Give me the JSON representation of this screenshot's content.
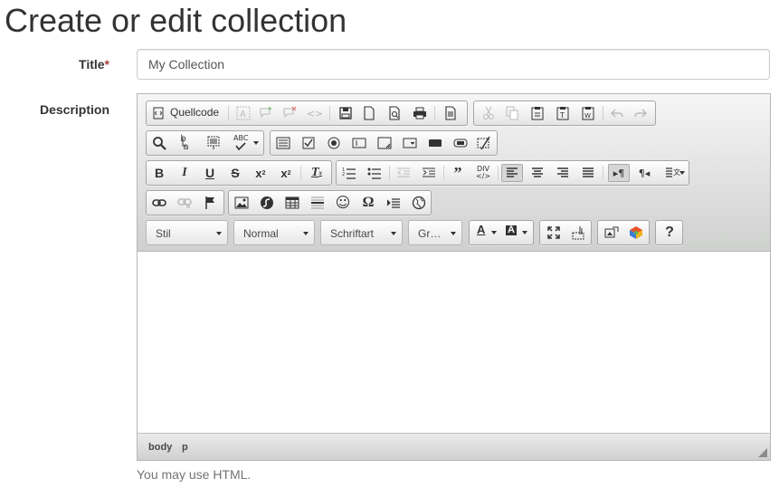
{
  "page": {
    "heading": "Create or edit collection"
  },
  "form": {
    "title_label": "Title",
    "required_mark": "*",
    "title_value": "My Collection",
    "description_label": "Description",
    "help_text": "You may use HTML."
  },
  "editor": {
    "source_label": "Quellcode",
    "combos": {
      "style": "Stil",
      "format": "Normal",
      "font": "Schriftart",
      "size": "Gr…"
    },
    "path": [
      "body",
      "p"
    ]
  },
  "colors": {
    "required": "#a94442",
    "toolbar_border": "#a6a6a6",
    "help": "#737373"
  }
}
